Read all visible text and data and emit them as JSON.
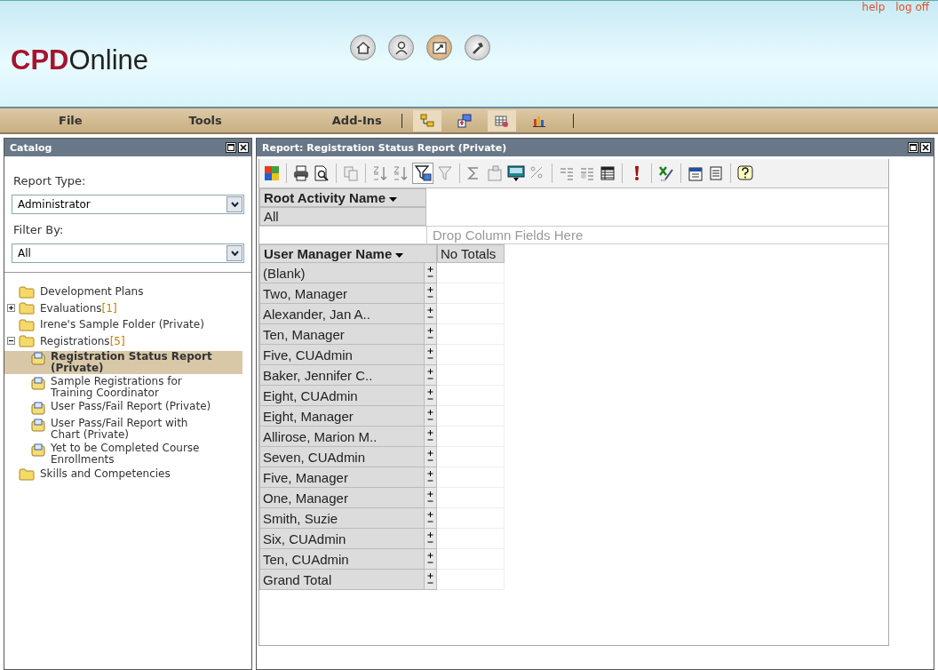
{
  "header": {
    "logo_bold": "CPD",
    "logo_rest": "Online",
    "links": [
      "help",
      "log off"
    ],
    "nav_buttons": [
      {
        "kind": "home",
        "selected": false
      },
      {
        "kind": "user",
        "selected": false
      },
      {
        "kind": "report",
        "selected": true
      },
      {
        "kind": "tools",
        "selected": false
      }
    ]
  },
  "menu": {
    "items": [
      "File",
      "Tools",
      "Add-Ins"
    ],
    "view_buttons": [
      {
        "kind": "tree",
        "selected": true
      },
      {
        "kind": "export",
        "selected": false
      },
      {
        "kind": "grid",
        "selected": true
      },
      {
        "kind": "chart",
        "selected": false
      }
    ]
  },
  "catalog": {
    "title": "Catalog",
    "report_type_label": "Report Type:",
    "report_type": "Administrator",
    "filter_label": "Filter By:",
    "filter": "All",
    "tree": [
      {
        "kind": "folder",
        "label": "Development Plans"
      },
      {
        "kind": "folder",
        "label": "Evaluations",
        "count": "[1]",
        "expanded": false
      },
      {
        "kind": "folder",
        "label": "Irene's Sample Folder (Private)"
      },
      {
        "kind": "folder",
        "label": "Registrations",
        "count": "[5]",
        "expanded": true,
        "children": [
          {
            "kind": "report",
            "label": "Registration Status Report (Private)",
            "selected": true
          },
          {
            "kind": "report",
            "label": "Sample Registrations for Training Coordinator",
            "selected": false
          },
          {
            "kind": "report",
            "label": "User Pass/Fail Report (Private)",
            "selected": false
          },
          {
            "kind": "report",
            "label": "User Pass/Fail Report with Chart (Private)",
            "selected": false
          },
          {
            "kind": "report",
            "label": "Yet to be Completed Course Enrollments",
            "selected": false
          }
        ]
      },
      {
        "kind": "folder",
        "label": "Skills and Competencies"
      }
    ]
  },
  "report": {
    "title": "Report: Registration Status Report (Private)",
    "filter_field": "Root Activity Name",
    "filter_value": "All",
    "column_drop_hint": "Drop Column Fields Here",
    "row_field": "User Manager Name",
    "column_header": "No Totals",
    "rows": [
      "(Blank)",
      "Two, Manager",
      "Alexander, Jan A..",
      "Ten, Manager",
      "Five, CUAdmin",
      "Baker, Jennifer C..",
      "Eight, CUAdmin",
      "Eight, Manager",
      "Allirose, Marion M..",
      "Seven, CUAdmin",
      "Five, Manager",
      "One, Manager",
      "Smith, Suzie",
      "Six, CUAdmin",
      "Ten, CUAdmin",
      "Grand Total"
    ]
  }
}
